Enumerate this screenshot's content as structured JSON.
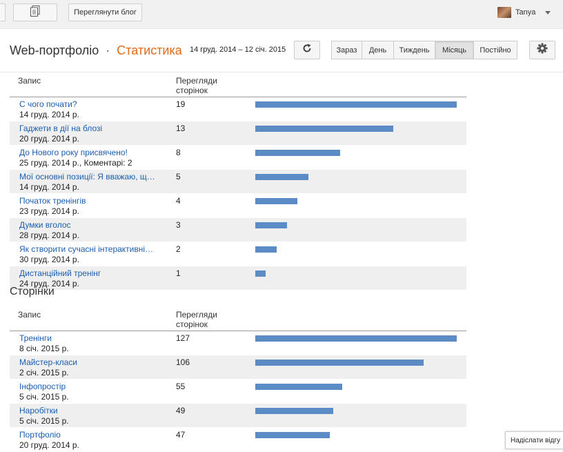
{
  "topbar": {
    "view_blog_label": "Переглянути блог",
    "user_name": "Tanya"
  },
  "header": {
    "blog_name": "Web-портфоліо",
    "separator": "·",
    "section": "Статистика",
    "date_range": "14 груд. 2014 – 12 січ. 2015",
    "periods": [
      "Зараз",
      "День",
      "Тиждень",
      "Місяць",
      "Постійно"
    ],
    "active_period": "Місяць"
  },
  "posts_table": {
    "col_record": "Запис",
    "col_views": "Перегляди\nсторінок",
    "max_views": 19,
    "rows": [
      {
        "title": "С чого почати?",
        "meta": "14 груд. 2014 р.",
        "views": 19
      },
      {
        "title": "Гаджети в дії на блозі",
        "meta": "20 груд. 2014 р.",
        "views": 13
      },
      {
        "title": "До Нового року присвячено!",
        "meta": "25 груд. 2014 р., Коментарі: 2",
        "views": 8
      },
      {
        "title": "Мої основні позиції: Я вважаю, щ…",
        "meta": "14 груд. 2014 р.",
        "views": 5
      },
      {
        "title": "Початок тренінгів",
        "meta": "23 груд. 2014 р.",
        "views": 4
      },
      {
        "title": "Думки вголос",
        "meta": "28 груд. 2014 р.",
        "views": 3
      },
      {
        "title": "Як створити сучасні інтерактивні…",
        "meta": "30 груд. 2014 р.",
        "views": 2
      },
      {
        "title": "Дистанційний тренінг",
        "meta": "24 груд. 2014 р.",
        "views": 1
      }
    ]
  },
  "pages_section_title": "Сторінки",
  "pages_table": {
    "col_record": "Запис",
    "col_views": "Перегляди\nсторінок",
    "max_views": 127,
    "rows": [
      {
        "title": "Тренінги",
        "meta": "8 січ. 2015 р.",
        "views": 127
      },
      {
        "title": "Майстер-класи",
        "meta": "2 січ. 2015 р.",
        "views": 106
      },
      {
        "title": "Інфопростір",
        "meta": "5 січ. 2015 р.",
        "views": 55
      },
      {
        "title": "Наробітки",
        "meta": "5 січ. 2015 р.",
        "views": 49
      },
      {
        "title": "Портфоліо",
        "meta": "20 груд. 2014 р.",
        "views": 47
      }
    ]
  },
  "feedback_label": "Надіслати відгу",
  "colors": {
    "accent": "#e06c1b",
    "bar": "#5b8cc6",
    "link": "#1a5db0"
  }
}
